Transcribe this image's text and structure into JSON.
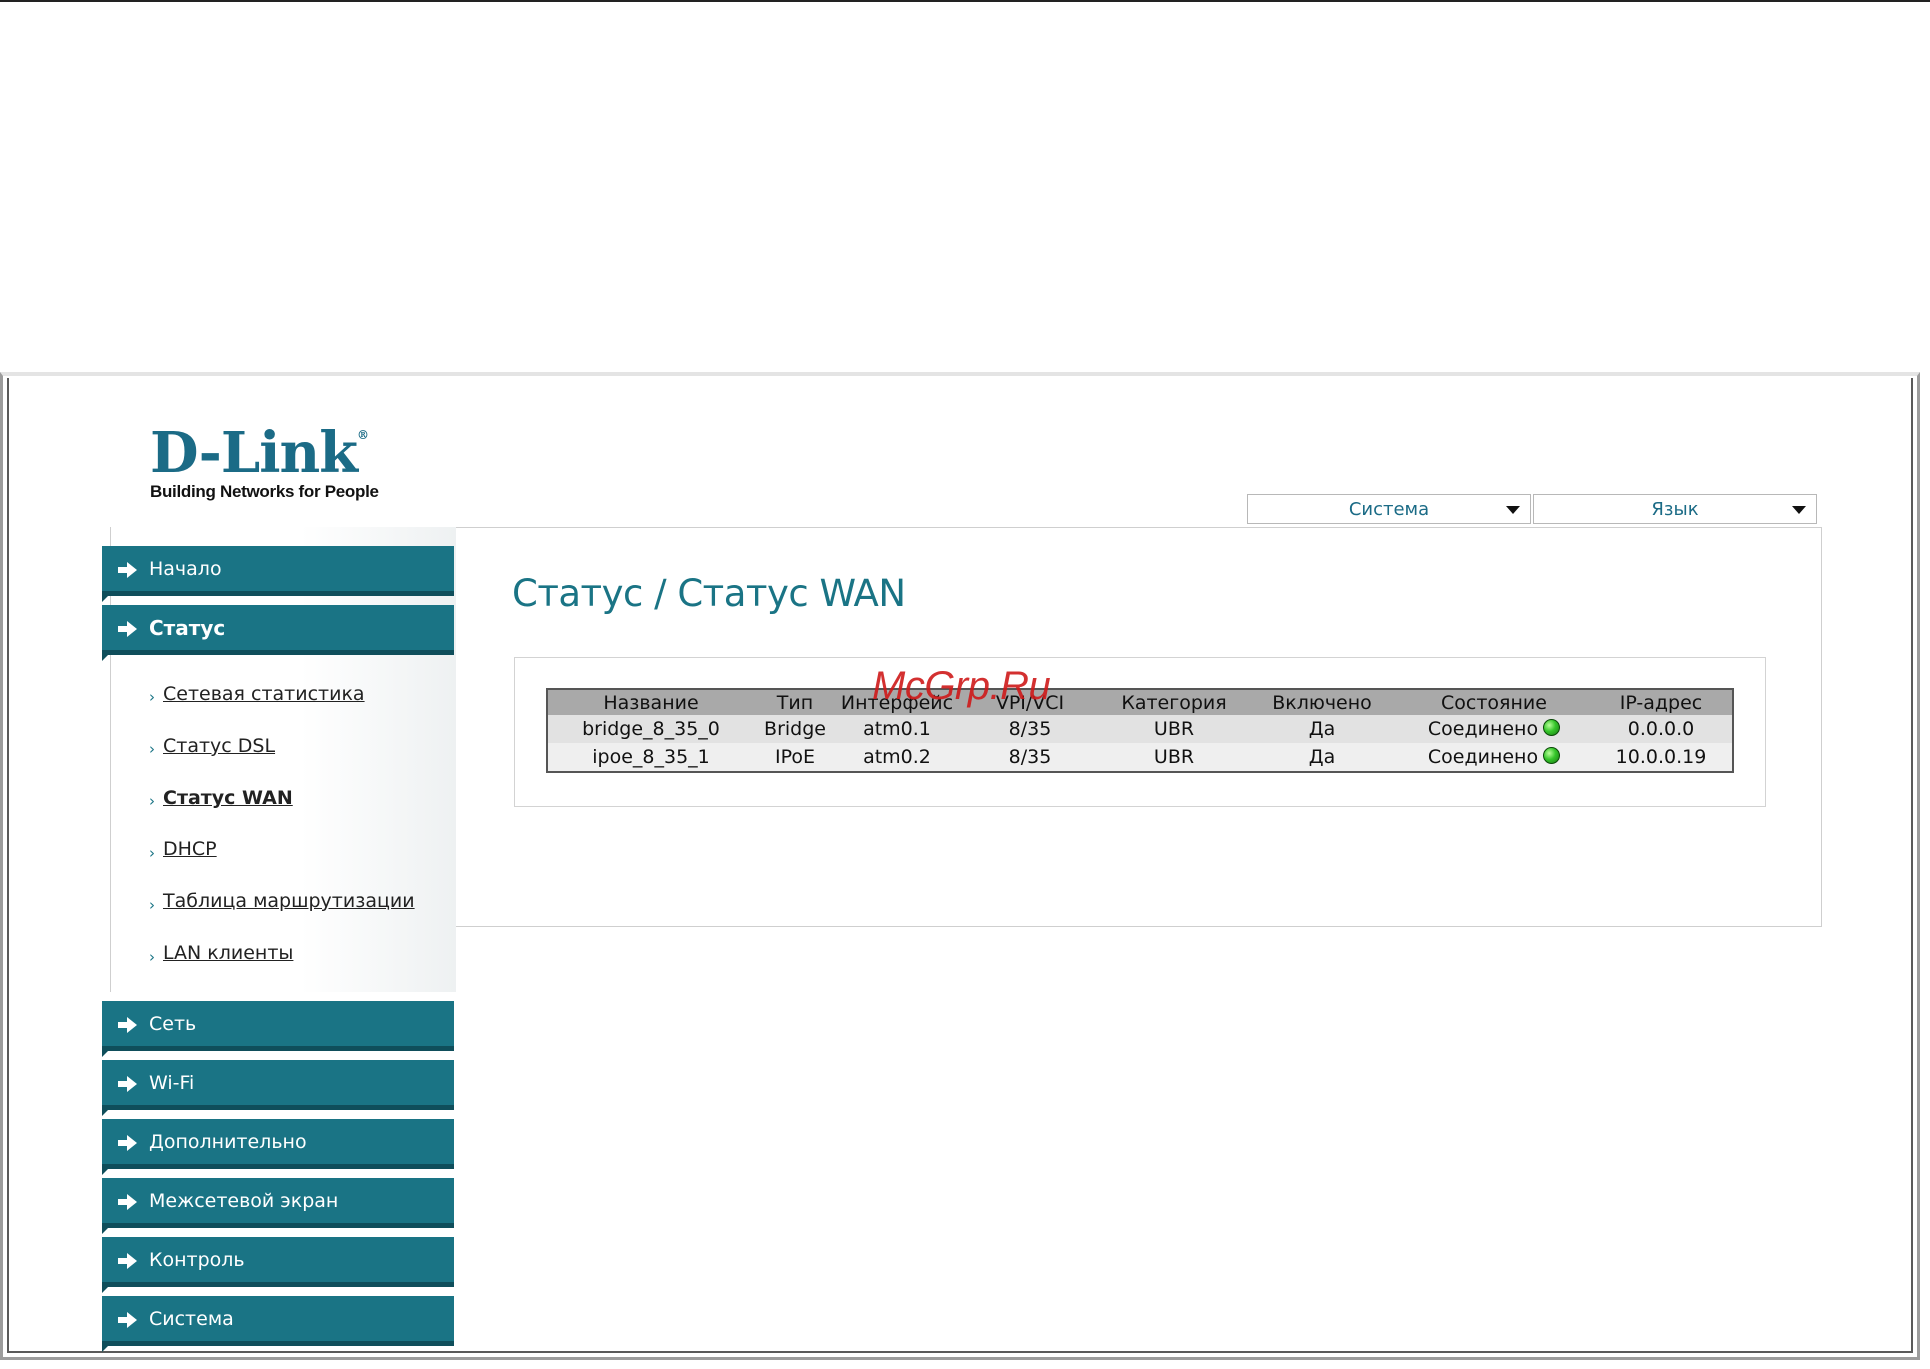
{
  "logo": {
    "brand": "D-Link",
    "mark": "®",
    "tagline": "Building Networks for People"
  },
  "header": {
    "system_dropdown": "Система",
    "language_dropdown": "Язык"
  },
  "sidebar": {
    "nav": [
      {
        "label": "Начало"
      },
      {
        "label": "Статус"
      },
      {
        "label": "Сеть"
      },
      {
        "label": "Wi-Fi"
      },
      {
        "label": "Дополнительно"
      },
      {
        "label": "Межсетевой экран"
      },
      {
        "label": "Контроль"
      },
      {
        "label": "Система"
      }
    ],
    "status_submenu": [
      {
        "label": "Сетевая статистика"
      },
      {
        "label": "Статус DSL"
      },
      {
        "label": "Статус WAN"
      },
      {
        "label": "DHCP"
      },
      {
        "label": "Таблица маршрутизации"
      },
      {
        "label": "LAN клиенты"
      }
    ]
  },
  "main": {
    "title": "Статус / Статус WAN",
    "table": {
      "headers": [
        "Название",
        "Тип",
        "Интерфейс",
        "VPI/VCI",
        "Категория",
        "Включено",
        "Состояние",
        "IP-адрес"
      ],
      "rows": [
        [
          "bridge_8_35_0",
          "Bridge",
          "atm0.1",
          "8/35",
          "UBR",
          "Да",
          "Соединено",
          "0.0.0.0"
        ],
        [
          "ipoe_8_35_1",
          "IPoE",
          "atm0.2",
          "8/35",
          "UBR",
          "Да",
          "Соединено",
          "10.0.0.19"
        ]
      ],
      "status_color": "#35c52a"
    }
  },
  "watermark": "McGrp.Ru",
  "colors": {
    "accent": "#1a7485",
    "accent_dark": "#0f4e5b",
    "brand": "#1b6b86"
  }
}
